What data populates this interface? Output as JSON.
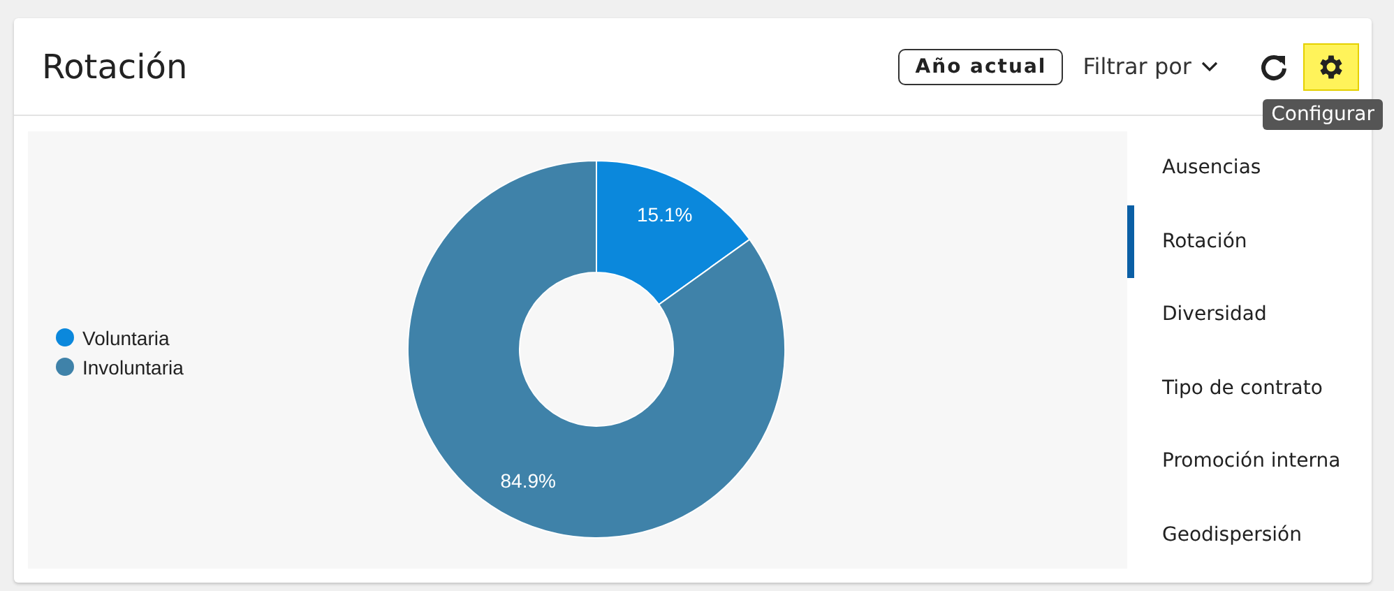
{
  "card": {
    "title": "Rotación",
    "period_button": "Año actual",
    "filter": "Filtrar por",
    "tooltip": "Configurar"
  },
  "legend": [
    {
      "color": "#0b88dc"
    },
    {
      "color": "#3f82a9"
    }
  ],
  "chart_data": {
    "type": "donut",
    "categories": [
      "Voluntaria",
      "Involuntaria"
    ],
    "values": [
      15.1,
      84.9
    ],
    "data_labels": true,
    "value_labels": [
      "15.1%",
      "84.9%"
    ]
  },
  "sidebar": {
    "items": [
      {
        "label": "Ausencias",
        "selected": false
      },
      {
        "label": "Rotación",
        "selected": true
      },
      {
        "label": "Diversidad",
        "selected": false
      },
      {
        "label": "Tipo de contrato",
        "selected": false
      },
      {
        "label": "Promoción interna",
        "selected": false
      },
      {
        "label": "Geodispersión",
        "selected": false
      }
    ]
  }
}
